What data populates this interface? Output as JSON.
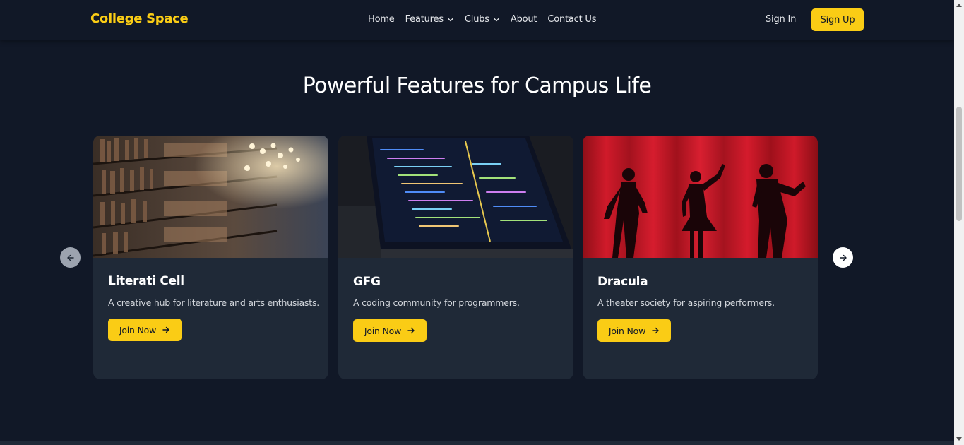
{
  "navbar": {
    "brand": "College Space",
    "links": [
      {
        "label": "Home",
        "dropdown": false
      },
      {
        "label": "Features",
        "dropdown": true
      },
      {
        "label": "Clubs",
        "dropdown": true
      },
      {
        "label": "About",
        "dropdown": false
      },
      {
        "label": "Contact Us",
        "dropdown": false
      }
    ],
    "sign_in": "Sign In",
    "sign_up": "Sign Up"
  },
  "section": {
    "title": "Powerful Features for Campus Life"
  },
  "cards": [
    {
      "title": "Literati Cell",
      "description": "A creative hub for literature and arts enthusiasts.",
      "button": "Join Now",
      "image": "library-bookshelves-photo"
    },
    {
      "title": "GFG",
      "description": "A coding community for programmers.",
      "button": "Join Now",
      "image": "laptop-code-editor-photo"
    },
    {
      "title": "Dracula",
      "description": "A theater society for aspiring performers.",
      "button": "Join Now",
      "image": "theater-silhouettes-red-curtain-photo"
    }
  ],
  "carousel": {
    "prev_icon": "arrow-left-icon",
    "next_icon": "arrow-right-icon"
  },
  "colors": {
    "background": "#111827",
    "card": "#1f2937",
    "accent": "#facc15"
  }
}
